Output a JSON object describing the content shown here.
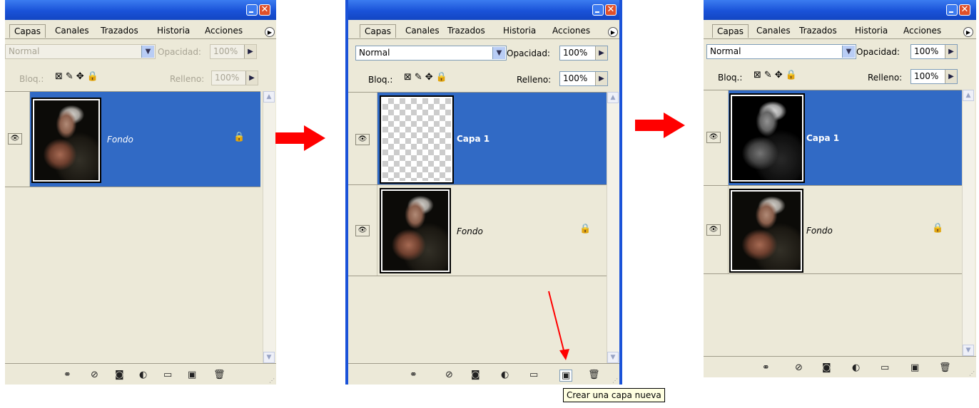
{
  "tabs": [
    "Capas",
    "Canales",
    "Trazados",
    "Historia",
    "Acciones"
  ],
  "blend_mode": "Normal",
  "opacity_label": "Opacidad:",
  "opacity_value": "100%",
  "lock_label": "Bloq.:",
  "fill_label": "Relleno:",
  "fill_value": "100%",
  "layer_fondo": "Fondo",
  "layer_capa1": "Capa 1",
  "tooltip": "Crear una capa nueva",
  "colors": {
    "selection": "#316ac5",
    "panel": "#ece9d8",
    "arrow": "#ff0000"
  },
  "icons": [
    "minimize-icon",
    "close-icon",
    "panel-menu-icon",
    "eye-icon",
    "lock-icon",
    "link-icon",
    "layer-style-icon",
    "mask-icon",
    "adjustment-icon",
    "folder-icon",
    "new-layer-icon",
    "trash-icon"
  ]
}
